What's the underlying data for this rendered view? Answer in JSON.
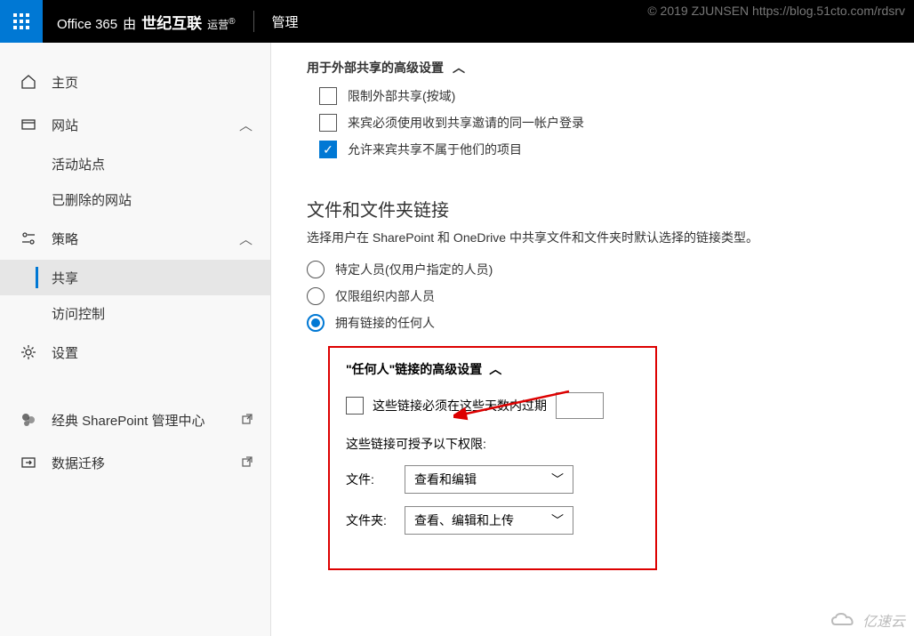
{
  "watermark": "© 2019 ZJUNSEN https://blog.51cto.com/rdsrv",
  "topbar": {
    "brand_prefix": "Office 365",
    "brand_by": "由",
    "brand_logo": "世纪互联",
    "brand_suffix": "运营",
    "admin": "管理"
  },
  "sidebar": {
    "home": "主页",
    "sites": {
      "label": "网站",
      "active_sites": "活动站点",
      "deleted_sites": "已删除的网站"
    },
    "policy": {
      "label": "策略",
      "sharing": "共享",
      "access_control": "访问控制"
    },
    "settings": "设置",
    "classic": "经典 SharePoint 管理中心",
    "migration": "数据迁移"
  },
  "external_sharing": {
    "title": "用于外部共享的高级设置",
    "cb1": "限制外部共享(按域)",
    "cb2": "来宾必须使用收到共享邀请的同一帐户登录",
    "cb3": "允许来宾共享不属于他们的项目"
  },
  "links": {
    "title": "文件和文件夹链接",
    "desc": "选择用户在 SharePoint 和 OneDrive 中共享文件和文件夹时默认选择的链接类型。",
    "r1": "特定人员(仅用户指定的人员)",
    "r2": "仅限组织内部人员",
    "r3": "拥有链接的任何人"
  },
  "anyone": {
    "title": "\"任何人\"链接的高级设置",
    "expire": "这些链接必须在这些天数内过期",
    "perm": "这些链接可授予以下权限:",
    "file_label": "文件:",
    "file_value": "查看和编辑",
    "folder_label": "文件夹:",
    "folder_value": "查看、编辑和上传"
  },
  "yisu": "亿速云"
}
